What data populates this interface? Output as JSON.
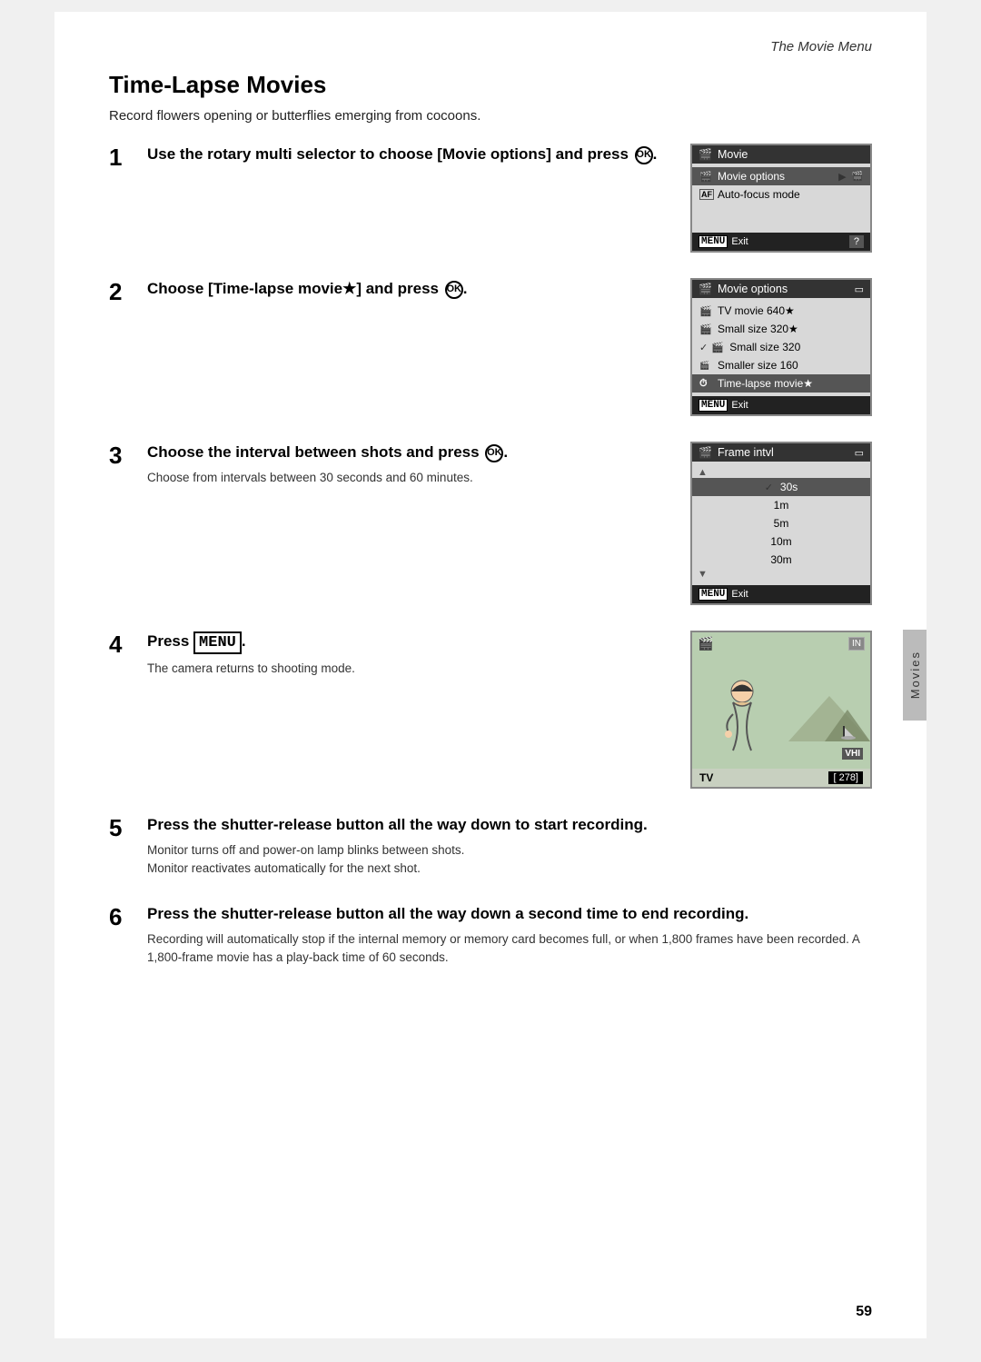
{
  "header": {
    "title": "The Movie Menu"
  },
  "page": {
    "title": "Time-Lapse Movies",
    "subtitle": "Record flowers opening or butterflies emerging from cocoons.",
    "page_number": "59"
  },
  "sidebar": {
    "label": "Movies"
  },
  "steps": [
    {
      "number": "1",
      "heading": "Use the rotary multi selector to choose [Movie options] and press Ⓢ.",
      "desc": "",
      "screen": {
        "titlebar": "Movie",
        "rows": [
          {
            "text": "Movie options",
            "icon": "▶",
            "selected": true
          },
          {
            "text": "Auto-focus mode",
            "icon": "AF",
            "selected": false
          }
        ],
        "footer": "MENU Exit",
        "footer_icon": "?"
      }
    },
    {
      "number": "2",
      "heading": "Choose [Time-lapse movie★] and press Ⓢ.",
      "desc": "",
      "screen": {
        "titlebar": "Movie options",
        "rows": [
          {
            "text": "TV movie 640★",
            "icon": "▶",
            "selected": false
          },
          {
            "text": "Small size 320★",
            "icon": "",
            "selected": false
          },
          {
            "text": "Small size 320",
            "icon": "",
            "selected": false,
            "check": "✓"
          },
          {
            "text": "Smaller size 160",
            "icon": "",
            "selected": false
          },
          {
            "text": "Time-lapse movie★",
            "icon": "",
            "selected": true
          }
        ],
        "footer": "MENU Exit"
      }
    },
    {
      "number": "3",
      "heading": "Choose the interval between shots and press Ⓢ.",
      "desc": "Choose from intervals between 30 seconds and 60 minutes.",
      "screen": {
        "titlebar": "Frame intvl",
        "rows": [
          {
            "text": "30s",
            "selected": true,
            "check": "✓"
          },
          {
            "text": "1m",
            "selected": false
          },
          {
            "text": "5m",
            "selected": false
          },
          {
            "text": "10m",
            "selected": false
          },
          {
            "text": "30m",
            "selected": false
          }
        ],
        "footer": "MENU Exit"
      }
    },
    {
      "number": "4",
      "heading": "Press MENU.",
      "desc": "The camera returns to shooting mode.",
      "camera_screen": {
        "top_left_icon": "🎬",
        "top_right": "IN",
        "bottom_left": "TV",
        "frame_count": "[ 278]",
        "vhi": "VHI"
      }
    },
    {
      "number": "5",
      "heading": "Press the shutter-release button all the way down to start recording.",
      "desc_lines": [
        "Monitor turns off and power-on lamp blinks between shots.",
        "Monitor reactivates automatically for the next shot."
      ]
    },
    {
      "number": "6",
      "heading": "Press the shutter-release button all the way down a second time to end recording.",
      "desc_lines": [
        "Recording will automatically stop if the internal memory or memory card becomes full, or when 1,800 frames have been recorded. A 1,800-frame movie has a play-back time of 60 seconds."
      ]
    }
  ]
}
